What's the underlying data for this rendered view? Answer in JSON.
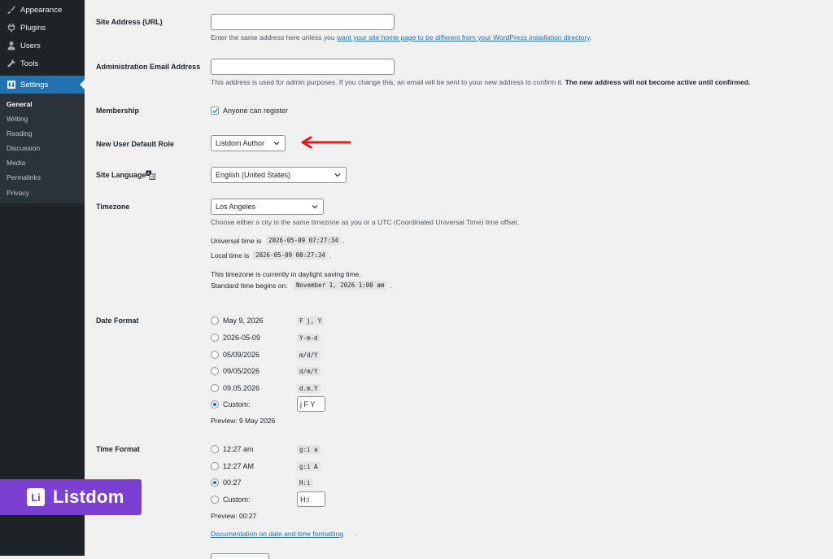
{
  "sidebar": {
    "menu": [
      {
        "label": "Appearance",
        "icon": "paintbrush-icon"
      },
      {
        "label": "Plugins",
        "icon": "plug-icon"
      },
      {
        "label": "Users",
        "icon": "users-icon"
      },
      {
        "label": "Tools",
        "icon": "wrench-icon"
      },
      {
        "label": "Settings",
        "icon": "settings-icon"
      }
    ],
    "submenu": [
      "General",
      "Writing",
      "Reading",
      "Discussion",
      "Media",
      "Permalinks",
      "Privacy"
    ]
  },
  "site_address": {
    "label": "Site Address (URL)",
    "value": "",
    "desc_before": "Enter the same address here unless you ",
    "desc_link": "want your site home page to be different from your WordPress installation directory",
    "desc_after": "."
  },
  "admin_email": {
    "label": "Administration Email Address",
    "value": "",
    "desc": "This address is used for admin purposes. If you change this, an email will be sent to your new address to confirm it. ",
    "desc_bold": "The new address will not become active until confirmed."
  },
  "membership": {
    "label": "Membership",
    "checkbox_label": "Anyone can register",
    "checked": true
  },
  "default_role": {
    "label": "New User Default Role",
    "value": "Listdom Author"
  },
  "site_language": {
    "label": "Site Language",
    "value": "English (United States)"
  },
  "timezone": {
    "label": "Timezone",
    "value": "Los Angeles",
    "desc": "Choose either a city in the same timezone as you or a UTC (Coordinated Universal Time) time offset.",
    "universal_label": "Universal time is",
    "universal_value": "2026-05-09 07:27:34",
    "local_label": "Local time is",
    "local_value": "2026-05-09 00:27:34",
    "dst_line": "This timezone is currently in daylight saving time.",
    "standard_label": "Standard time begins on:",
    "standard_value": "November 1, 2026 1:00 am",
    "period": "."
  },
  "date_format": {
    "label": "Date Format",
    "options": [
      {
        "label": "May 9, 2026",
        "code": "F j, Y"
      },
      {
        "label": "2026-05-09",
        "code": "Y-m-d"
      },
      {
        "label": "05/09/2026",
        "code": "m/d/Y"
      },
      {
        "label": "09/05/2026",
        "code": "d/m/Y"
      },
      {
        "label": "09.05.2026",
        "code": "d.m.Y"
      }
    ],
    "custom_label": "Custom:",
    "custom_value": "j F Y",
    "preview": "Preview: 9 May 2026"
  },
  "time_format": {
    "label": "Time Format",
    "options": [
      {
        "label": "12:27 am",
        "code": "g:i a"
      },
      {
        "label": "12:27 AM",
        "code": "g:i A"
      },
      {
        "label": "00:27",
        "code": "H:i"
      }
    ],
    "custom_label": "Custom:",
    "custom_value": "H:i",
    "preview": "Preview: 00:27",
    "doc_link": "Documentation on date and time formatting",
    "doc_period": "."
  },
  "badge": {
    "logo_text": "Li",
    "name": "Listdom"
  },
  "colors": {
    "accent": "#2271b1",
    "sidebar": "#1d2327",
    "badge": "#7b3fd1",
    "arrow": "#e01b1b"
  }
}
